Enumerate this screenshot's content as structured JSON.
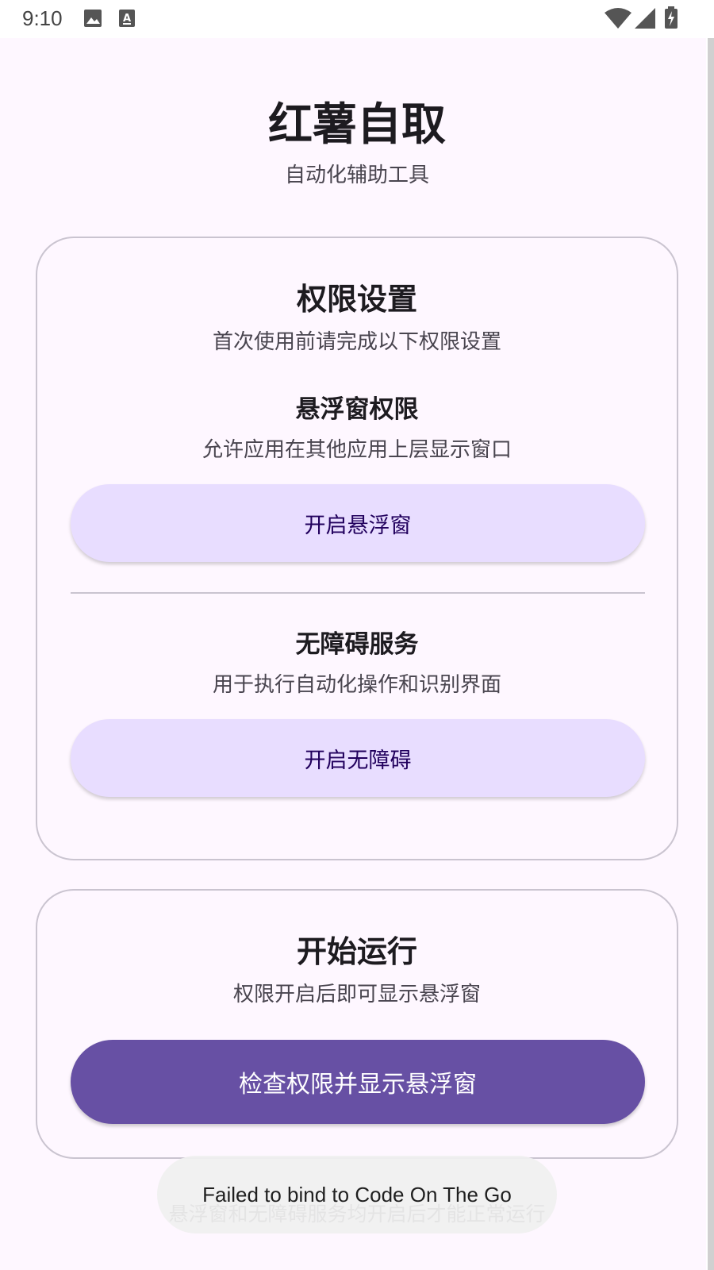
{
  "status_bar": {
    "time": "9:10",
    "icons": [
      "image-icon",
      "a-text-icon",
      "wifi-icon",
      "signal-icon",
      "battery-charging-icon"
    ]
  },
  "header": {
    "title": "红薯自取",
    "subtitle": "自动化辅助工具"
  },
  "permissions_card": {
    "title": "权限设置",
    "description": "首次使用前请完成以下权限设置",
    "overlay": {
      "title": "悬浮窗权限",
      "description": "允许应用在其他应用上层显示窗口",
      "button_label": "开启悬浮窗"
    },
    "accessibility": {
      "title": "无障碍服务",
      "description": "用于执行自动化操作和识别界面",
      "button_label": "开启无障碍"
    }
  },
  "run_card": {
    "title": "开始运行",
    "description": "权限开启后即可显示悬浮窗",
    "button_label": "检查权限并显示悬浮窗"
  },
  "hint": "悬浮窗和无障碍服务均开启后才能正常运行",
  "toast": "Failed to bind to Code On The Go",
  "colors": {
    "background": "#fef7ff",
    "primary": "#6750a4",
    "tonal_button": "#e8ddff",
    "outline": "#cac4d0"
  }
}
